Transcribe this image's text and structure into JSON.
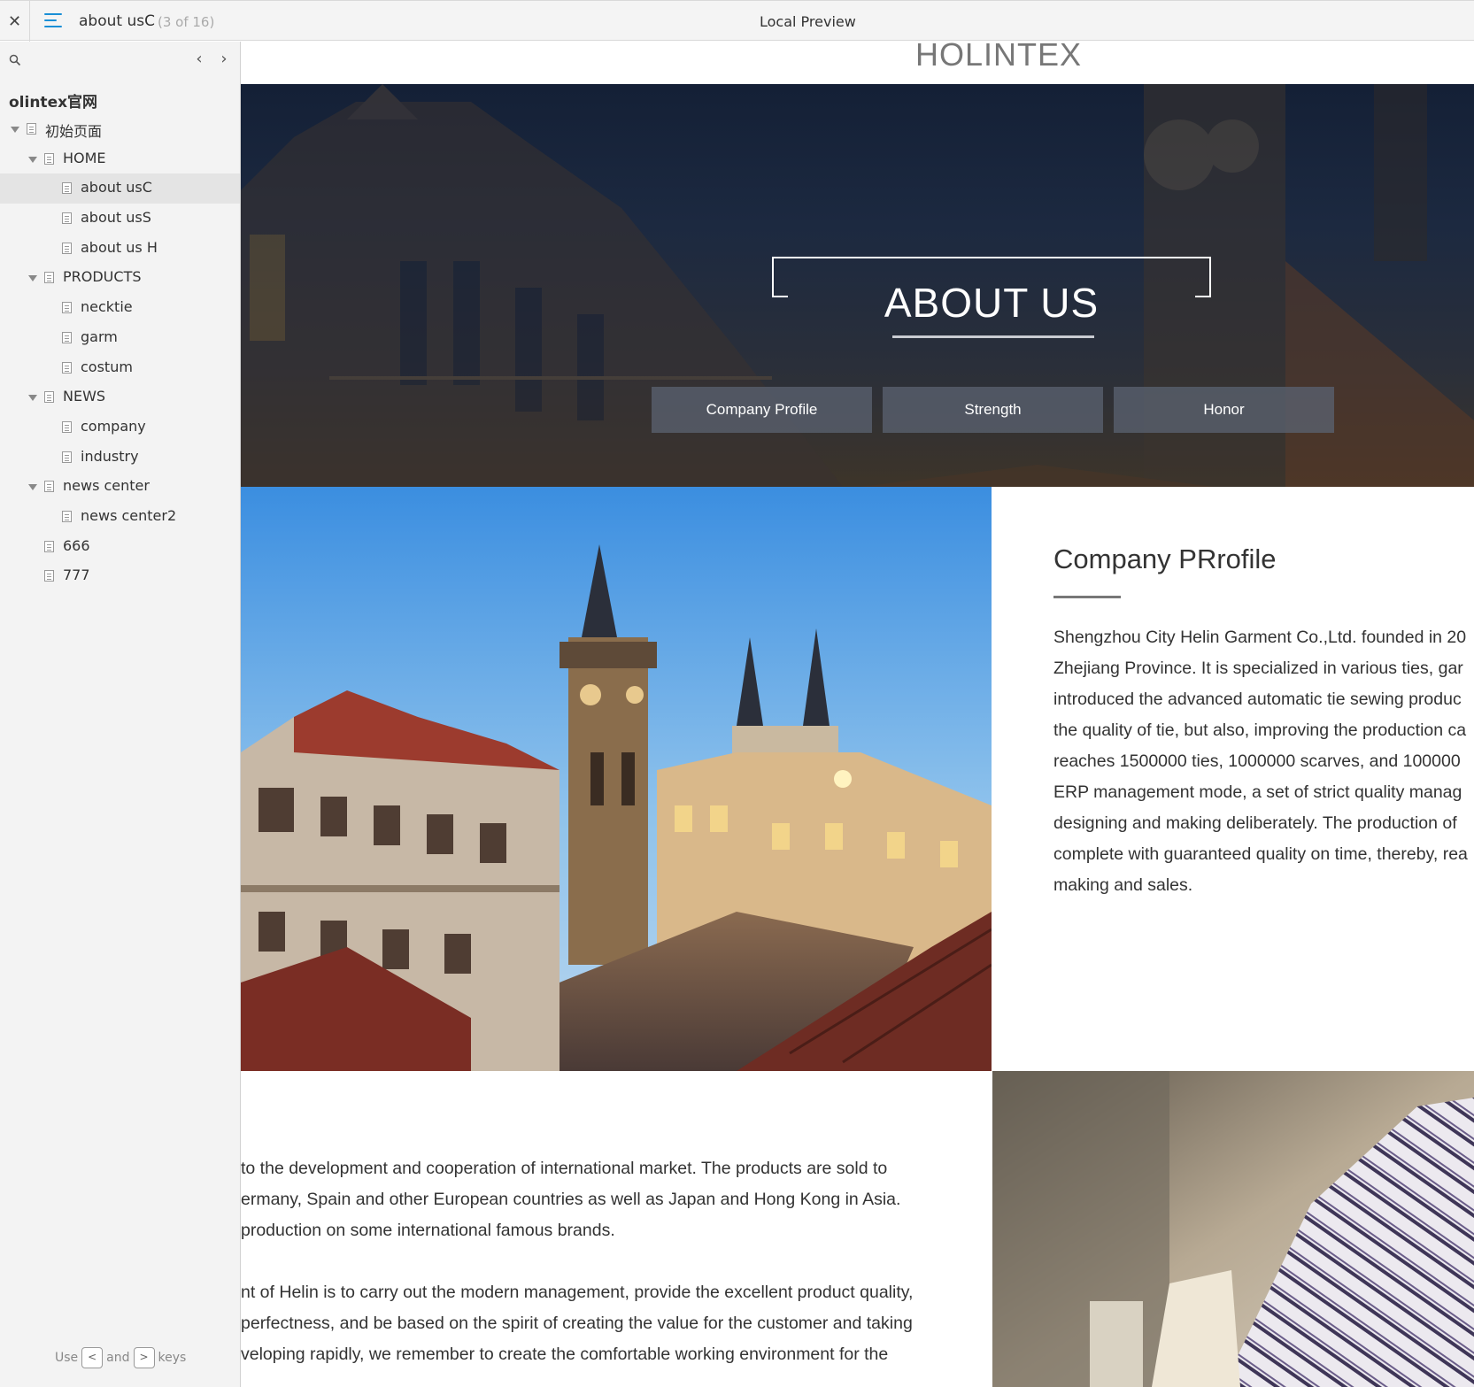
{
  "toolbar": {
    "close_glyph": "✕",
    "page_name": "about usC",
    "page_count": "(3 of 16)",
    "preview_label": "Local Preview"
  },
  "sidebar": {
    "prev_glyph": "‹",
    "next_glyph": "›",
    "project_title": "olintex官网",
    "tree": [
      {
        "label": "初始页面",
        "level": 0,
        "expanded": true
      },
      {
        "label": "HOME",
        "level": 1,
        "expanded": true
      },
      {
        "label": "about usC",
        "level": 2,
        "selected": true
      },
      {
        "label": "about usS",
        "level": 2
      },
      {
        "label": "about us H",
        "level": 2
      },
      {
        "label": "PRODUCTS",
        "level": 1,
        "expanded": true
      },
      {
        "label": "necktie",
        "level": 2
      },
      {
        "label": "garm",
        "level": 2
      },
      {
        "label": "costum",
        "level": 2
      },
      {
        "label": "NEWS",
        "level": 1,
        "expanded": true
      },
      {
        "label": "company",
        "level": 2
      },
      {
        "label": "industry",
        "level": 2
      },
      {
        "label": "news center",
        "level": 1,
        "expanded": true
      },
      {
        "label": "news center2",
        "level": 2
      },
      {
        "label": "666",
        "level": 1
      },
      {
        "label": "777",
        "level": 1
      }
    ],
    "hint": {
      "use": "Use",
      "and": "and",
      "keys": "keys",
      "key_left": "<",
      "key_right": ">"
    }
  },
  "preview": {
    "logo": "HOLINTEX",
    "hero_title": "ABOUT US",
    "hero_tabs": [
      "Company Profile",
      "Strength",
      "Honor"
    ],
    "profile_title": "Company PRrofile",
    "profile_lines": [
      "Shengzhou City Helin Garment Co.,Ltd. founded in 20",
      "Zhejiang Province. It is specialized in various ties, gar",
      "introduced the advanced automatic tie sewing produc",
      "the quality of tie, but also, improving the production ca",
      "reaches 1500000 ties, 1000000 scarves, and 100000",
      "ERP management mode, a set of strict quality manag",
      "designing and making deliberately. The production of",
      "complete with guaranteed quality on time, thereby, rea",
      "making and sales."
    ],
    "lower_lines": [
      "to the development and cooperation of international market. The products are sold to",
      "ermany, Spain and other European countries as well as Japan and Hong Kong in Asia.",
      " production on some international famous brands.",
      "",
      "nt of Helin is to carry out the modern management, provide the excellent product quality,",
      "perfectness, and be based on the spirit of creating the value for the customer and taking",
      "veloping rapidly, we remember to create the comfortable working environment for the"
    ]
  },
  "colors": {
    "accent": "#1a8fd6",
    "hero_dark": "#142036",
    "tab_bg": "#5a6270"
  }
}
